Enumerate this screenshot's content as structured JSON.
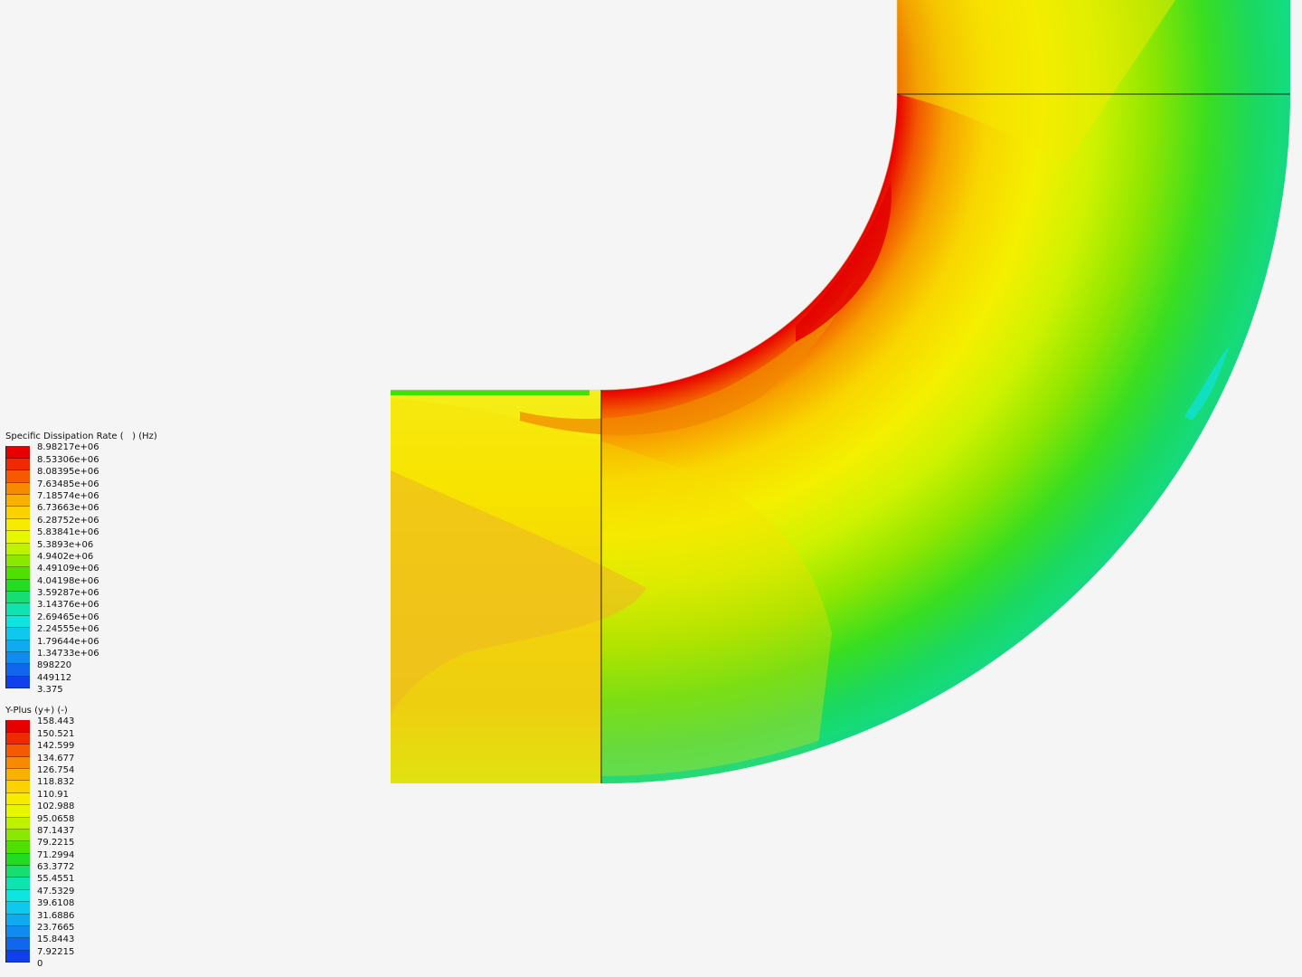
{
  "viewer": {
    "background": "#f5f5f5"
  },
  "legend_dissipation": {
    "title": "Specific Dissipation Rate (   ) (Hz)",
    "labels": [
      "8.98217e+06",
      "8.53306e+06",
      "8.08395e+06",
      "7.63485e+06",
      "7.18574e+06",
      "6.73663e+06",
      "6.28752e+06",
      "5.83841e+06",
      "5.3893e+06",
      "4.9402e+06",
      "4.49109e+06",
      "4.04198e+06",
      "3.59287e+06",
      "3.14376e+06",
      "2.69465e+06",
      "2.24555e+06",
      "1.79644e+06",
      "1.34733e+06",
      "898220",
      "449112",
      "3.375"
    ],
    "colors": [
      "#e60000",
      "#f02a00",
      "#f55a00",
      "#f78a00",
      "#f8b100",
      "#f9d200",
      "#f7ec00",
      "#e6f700",
      "#bdf200",
      "#8be800",
      "#4fe000",
      "#22dc22",
      "#17de70",
      "#10e2b0",
      "#10e4e0",
      "#10c8ee",
      "#10aaf0",
      "#108cf0",
      "#1066ec",
      "#1040ee"
    ]
  },
  "legend_yplus": {
    "title": "Y-Plus (y+) (-)",
    "labels": [
      "158.443",
      "150.521",
      "142.599",
      "134.677",
      "126.754",
      "118.832",
      "110.91",
      "102.988",
      "95.0658",
      "87.1437",
      "79.2215",
      "71.2994",
      "63.3772",
      "55.4551",
      "47.5329",
      "39.6108",
      "31.6886",
      "23.7665",
      "15.8443",
      "7.92215",
      "0"
    ],
    "colors": [
      "#e60000",
      "#f02a00",
      "#f55a00",
      "#f78a00",
      "#f8b100",
      "#f9d200",
      "#f7ec00",
      "#e6f700",
      "#bdf200",
      "#8be800",
      "#4fe000",
      "#22dc22",
      "#17de70",
      "#10e2b0",
      "#10e4e0",
      "#10c8ee",
      "#10aaf0",
      "#108cf0",
      "#1066ec",
      "#1040ee"
    ]
  }
}
